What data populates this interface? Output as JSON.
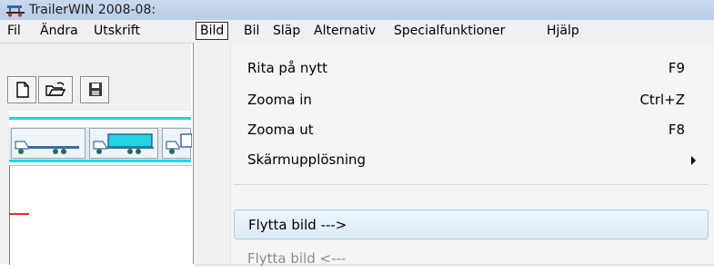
{
  "window": {
    "title": "TrailerWIN 2008-08:"
  },
  "menubar": {
    "items": [
      {
        "label": "Fil"
      },
      {
        "label": "Ändra"
      },
      {
        "label": "Utskrift"
      },
      {
        "label": "Bild"
      },
      {
        "label": "Bil"
      },
      {
        "label": "Släp"
      },
      {
        "label": "Alternativ"
      },
      {
        "label": "Specialfunktioner"
      },
      {
        "label": "Hjälp"
      }
    ],
    "active": "Bild"
  },
  "toolbar": {
    "buttons": [
      {
        "icon": "new-document-icon"
      },
      {
        "icon": "open-folder-icon"
      },
      {
        "icon": "save-disk-icon"
      }
    ],
    "vehicles": [
      {
        "icon": "flatbed-trailer-icon"
      },
      {
        "icon": "truck-cyan-body-icon"
      },
      {
        "icon": "truck-partial-icon"
      }
    ]
  },
  "dropdown": {
    "items": [
      {
        "label": "Rita på nytt",
        "shortcut": "F9"
      },
      {
        "label": "Zooma in",
        "shortcut": "Ctrl+Z"
      },
      {
        "label": "Zooma ut",
        "shortcut": "F8"
      },
      {
        "label": "Skärmupplösning",
        "submenu": true
      },
      {
        "label": "Flytta bild  --->",
        "state": "hover"
      },
      {
        "label": "Flytta bild  <---",
        "state": "disabled"
      }
    ]
  },
  "colors": {
    "accent_cyan": "#25d3e2",
    "hover_border": "#a7cbe8",
    "title_bar": "#c9d9ee"
  }
}
